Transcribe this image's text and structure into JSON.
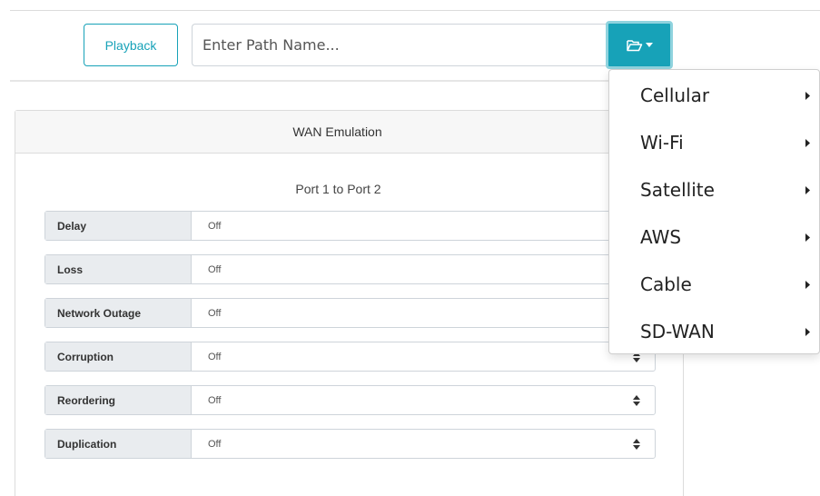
{
  "toolbar": {
    "playback_label": "Playback",
    "path_placeholder": "Enter Path Name...",
    "folder_icon": "folder-open-icon",
    "caret_icon": "caret-down-icon"
  },
  "panel": {
    "title": "WAN Emulation",
    "port_title": "Port 1 to Port 2",
    "rows": [
      {
        "label": "Delay",
        "value": "Off"
      },
      {
        "label": "Loss",
        "value": "Off"
      },
      {
        "label": "Network Outage",
        "value": "Off"
      },
      {
        "label": "Corruption",
        "value": "Off"
      },
      {
        "label": "Reordering",
        "value": "Off"
      },
      {
        "label": "Duplication",
        "value": "Off"
      }
    ]
  },
  "dropdown": {
    "items": [
      {
        "label": "Cellular"
      },
      {
        "label": "Wi-Fi"
      },
      {
        "label": "Satellite"
      },
      {
        "label": "AWS"
      },
      {
        "label": "Cable"
      },
      {
        "label": "SD-WAN"
      }
    ]
  },
  "colors": {
    "accent": "#17a2b8",
    "label_bg": "#e9ecef",
    "border": "#ced4da"
  }
}
